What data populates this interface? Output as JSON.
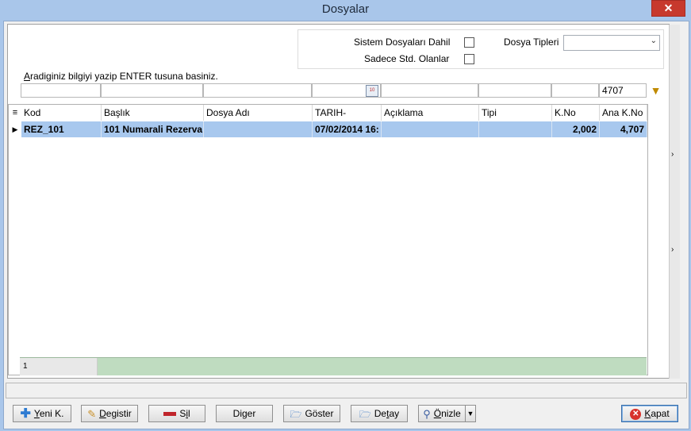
{
  "window": {
    "title": "Dosyalar",
    "close_glyph": "✕"
  },
  "filters": {
    "system_files_label": "Sistem Dosyaları Dahil",
    "std_only_label": "Sadece Std. Olanlar",
    "file_types_label": "Dosya Tipleri",
    "file_types_value": "",
    "hint_prefix": "A",
    "hint_rest": "radiginiz bilgiyi yazip ENTER tusuna basiniz.",
    "kno_filter_value": "4707"
  },
  "grid": {
    "columns": [
      "Kod",
      "Başlık",
      "Dosya Adı",
      "TARIH-",
      "Açıklama",
      "Tipi",
      "K.No",
      "Ana K.No"
    ],
    "rows": [
      {
        "kod": "REZ_101",
        "baslik": "101 Numarali Rezerva",
        "dosya_adi": "",
        "tarih": "07/02/2014 16:",
        "aciklama": "",
        "tipi": "",
        "kno": "2,002",
        "ana_kno": "4,707"
      }
    ],
    "footer_count": "1"
  },
  "buttons": {
    "new_underline": "Y",
    "new_rest": "eni K.",
    "edit_underline": "D",
    "edit_rest": "egistir",
    "delete_prefix": "S",
    "delete_underline": "i",
    "delete_rest": "l",
    "other": "Diger",
    "show": "Göster",
    "detail_prefix": "De",
    "detail_underline": "t",
    "detail_rest": "ay",
    "preview_underline": "Ö",
    "preview_rest": "nizle",
    "close_underline": "K",
    "close_rest": "apat"
  },
  "colors": {
    "title_bar": "#a9c6ea",
    "selected_row": "#a8c8ee",
    "close": "#c7392d"
  }
}
